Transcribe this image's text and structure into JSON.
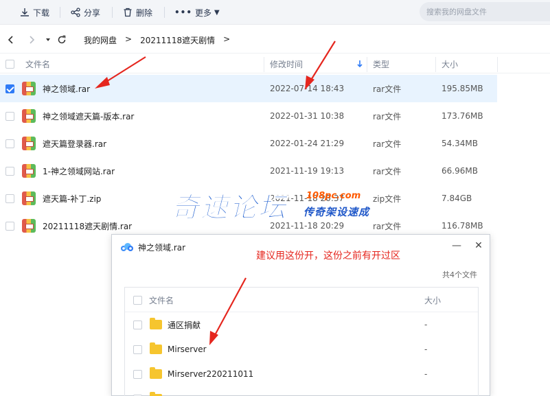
{
  "toolbar": {
    "download": "下载",
    "share": "分享",
    "delete": "删除",
    "more": "更多",
    "search_placeholder": "搜索我的网盘文件"
  },
  "nav": {
    "breadcrumbs": [
      "我的网盘",
      ">",
      "20211118遮天剧情",
      ">"
    ]
  },
  "table": {
    "headers": {
      "name": "文件名",
      "modified": "修改时间",
      "type": "类型",
      "size": "大小"
    },
    "sort_icon": "sort-down-arrow-icon",
    "rows": [
      {
        "name": "神之领域.rar",
        "modified": "2022-07-14 18:43",
        "type": "rar文件",
        "size": "195.85MB",
        "selected": true
      },
      {
        "name": "神之领域遮天篇-版本.rar",
        "modified": "2022-01-31 10:38",
        "type": "rar文件",
        "size": "173.76MB",
        "selected": false
      },
      {
        "name": "遮天篇登录器.rar",
        "modified": "2022-01-24 21:29",
        "type": "rar文件",
        "size": "54.34MB",
        "selected": false
      },
      {
        "name": "1-神之领域网站.rar",
        "modified": "2021-11-19 19:13",
        "type": "rar文件",
        "size": "66.96MB",
        "selected": false
      },
      {
        "name": "遮天篇-补丁.zip",
        "modified": "2021-11-18 20:37",
        "type": "zip文件",
        "size": "7.84GB",
        "selected": false
      },
      {
        "name": "20211118遮天剧情.rar",
        "modified": "2021-11-18 20:29",
        "type": "rar文件",
        "size": "116.78MB",
        "selected": false
      }
    ]
  },
  "watermark": {
    "brand": "奇速论坛",
    "url": "108pc.com",
    "tagline": "传奇架设速成"
  },
  "dialog": {
    "title": "神之领域.rar",
    "note": "建议用这份开，这份之前有开过区",
    "count": "共4个文件",
    "headers": {
      "name": "文件名",
      "size": "大小"
    },
    "rows": [
      {
        "name": "通区捐献",
        "size": "-"
      },
      {
        "name": "Mirserver",
        "size": "-"
      },
      {
        "name": "Mirserver220211011",
        "size": "-"
      },
      {
        "name": "",
        "size": "-"
      }
    ]
  },
  "colors": {
    "accent": "#2f7bf6",
    "selected_row": "#e8f3fe",
    "annotation_red": "#e5261e",
    "watermark_blue": "#1f5fd0",
    "watermark_orange": "#ff5a00"
  }
}
